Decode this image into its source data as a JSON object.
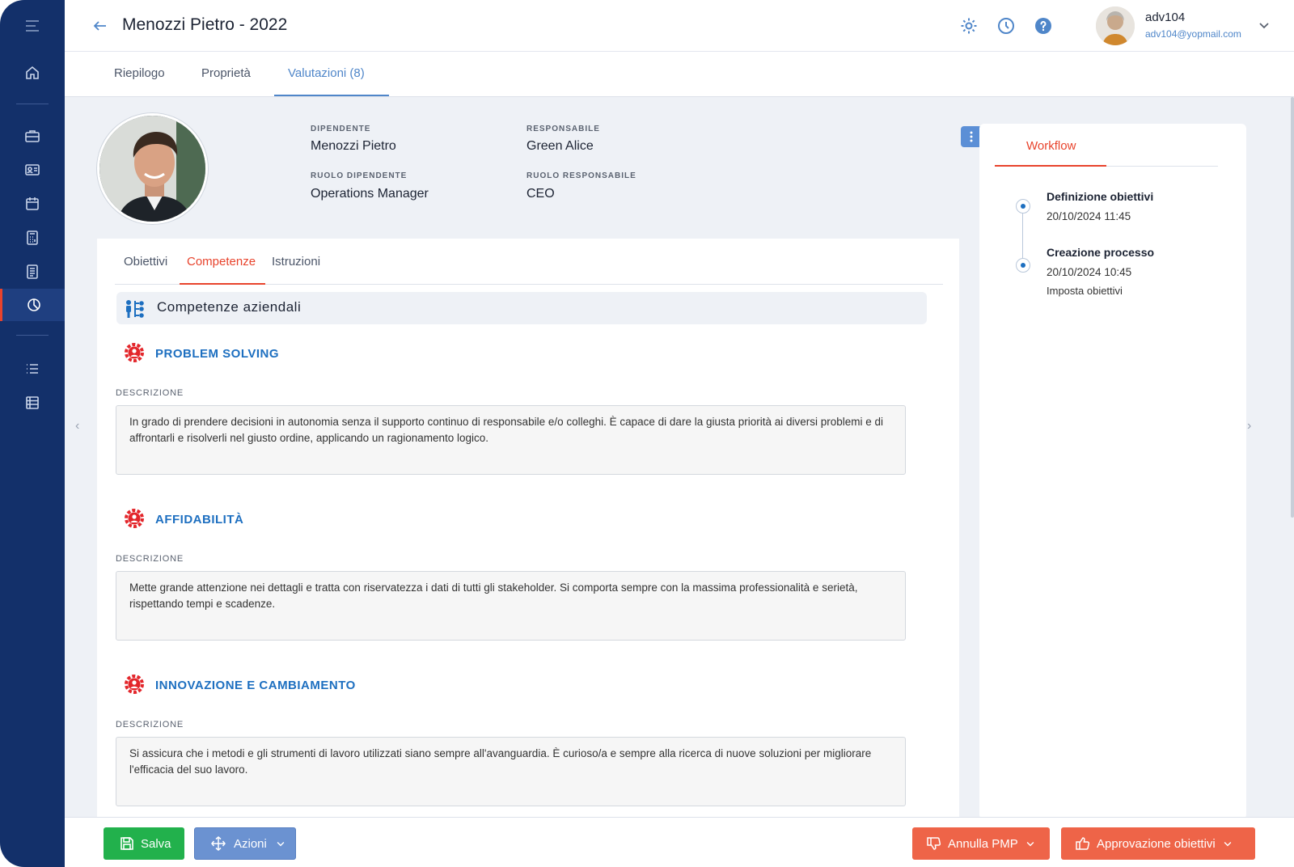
{
  "header": {
    "title": "Menozzi Pietro - 2022",
    "user_name": "adv104",
    "user_email": "adv104@yopmail.com"
  },
  "top_tabs": [
    {
      "label": "Riepilogo"
    },
    {
      "label": "Proprietà"
    },
    {
      "label": "Valutazioni (8)"
    }
  ],
  "profile": {
    "employee_label": "DIPENDENTE",
    "employee": "Menozzi Pietro",
    "manager_label": "RESPONSABILE",
    "manager": "Green Alice",
    "employee_role_label": "RUOLO DIPENDENTE",
    "employee_role": "Operations Manager",
    "manager_role_label": "RUOLO RESPONSABILE",
    "manager_role": "CEO"
  },
  "sub_tabs": [
    {
      "label": "Obiettivi"
    },
    {
      "label": "Competenze"
    },
    {
      "label": "Istruzioni"
    }
  ],
  "section": {
    "title": "Competenze aziendali"
  },
  "competences": [
    {
      "title": "PROBLEM SOLVING",
      "desc_label": "DESCRIZIONE",
      "description": "In grado di prendere decisioni in autonomia senza il supporto continuo di responsabile e/o colleghi. È capace di dare la giusta priorità ai diversi problemi e di affrontarli e risolverli nel giusto ordine, applicando un ragionamento logico."
    },
    {
      "title": "AFFIDABILITÀ",
      "desc_label": "DESCRIZIONE",
      "description": "Mette grande attenzione nei dettagli e tratta con riservatezza i dati di tutti gli stakeholder. Si comporta sempre con la massima professionalità e serietà, rispettando tempi e scadenze."
    },
    {
      "title": "INNOVAZIONE E CAMBIAMENTO",
      "desc_label": "DESCRIZIONE",
      "description": "Si assicura che i metodi e gli strumenti di lavoro utilizzati siano sempre all'avanguardia. È curioso/a e sempre alla ricerca di nuove soluzioni per migliorare l'efficacia del suo lavoro."
    }
  ],
  "workflow": {
    "tab": "Workflow",
    "steps": [
      {
        "title": "Definizione obiettivi",
        "date": "20/10/2024 11:45",
        "note": ""
      },
      {
        "title": "Creazione processo",
        "date": "20/10/2024 10:45",
        "note": "Imposta obiettivi"
      }
    ]
  },
  "footer": {
    "save": "Salva",
    "actions": "Azioni",
    "cancel": "Annulla PMP",
    "approve": "Approvazione obiettivi"
  },
  "colors": {
    "sidebar": "#13306a",
    "accent_blue": "#4f86c9",
    "accent_red": "#e8432c",
    "save_green": "#22b14c",
    "action_blue": "#6b92d1",
    "danger_orange": "#ee6448"
  },
  "icons": {
    "sidebar": [
      "menu-icon",
      "home-icon",
      "briefcase-icon",
      "id-card-icon",
      "calendar-icon",
      "calculator-icon",
      "document-icon",
      "pie-chart-icon",
      "list-icon",
      "table-icon"
    ],
    "header": [
      "back-arrow-icon",
      "gear-icon",
      "clock-icon",
      "help-icon",
      "chevron-down-icon"
    ]
  }
}
